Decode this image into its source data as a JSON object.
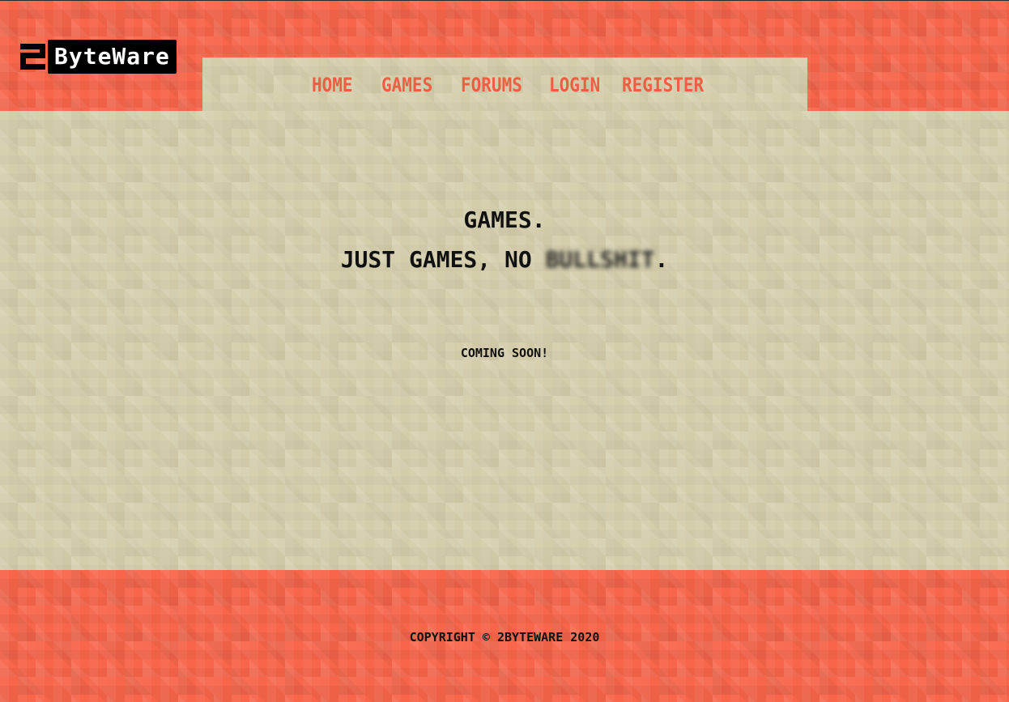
{
  "logo": {
    "mark_icon": "2-logo-mark-icon",
    "text": "ByteWare"
  },
  "nav": {
    "items": [
      {
        "label": "HOME"
      },
      {
        "label": "GAMES"
      },
      {
        "label": "FORUMS"
      },
      {
        "label": "LOGIN"
      },
      {
        "label": "REGISTER"
      }
    ]
  },
  "hero": {
    "line1": "GAMES.",
    "line2_prefix": "JUST GAMES, NO ",
    "line2_blurred": "BULLSHIT",
    "line2_suffix": "."
  },
  "status": {
    "text": "COMING SOON!"
  },
  "footer": {
    "copyright": "COPYRIGHT © 2BYTEWARE 2020"
  },
  "colors": {
    "accent_orange": "#f7654a",
    "nav_link": "#ee5e43",
    "beige": "#d3cdaa",
    "text_dark": "#111111"
  }
}
